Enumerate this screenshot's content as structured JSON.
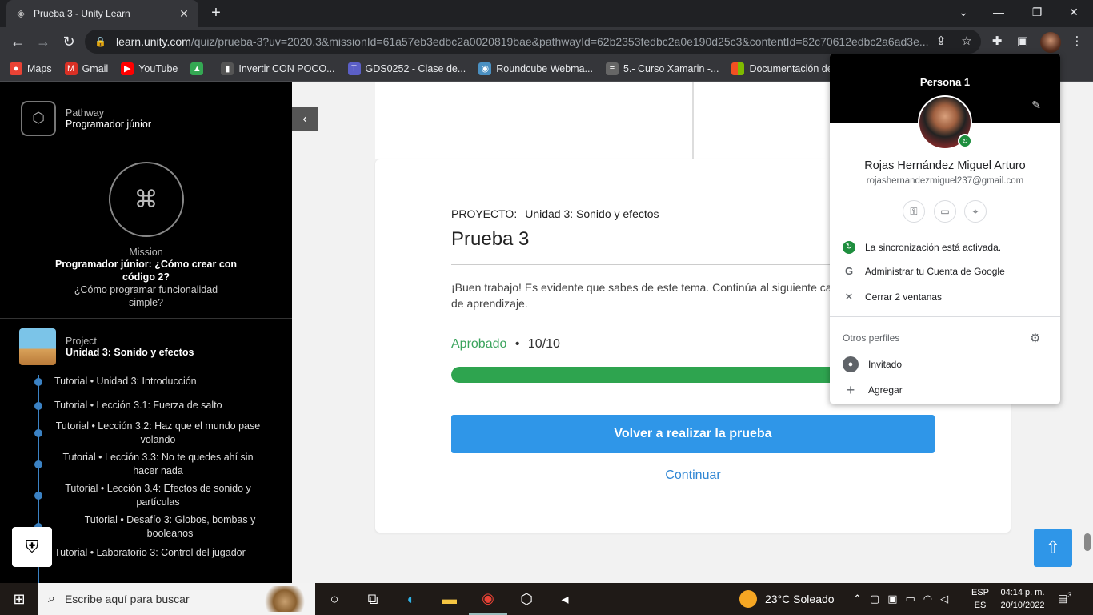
{
  "browser": {
    "tab_title": "Prueba 3 - Unity Learn",
    "url_host": "learn.unity.com",
    "url_rest": "/quiz/prueba-3?uv=2020.3&missionId=61a57eb3edbc2a0020819bae&pathwayId=62b2353fedbc2a0e190d25c3&contentId=62c70612edbc2a6ad3e...",
    "bookmarks": [
      {
        "label": "Maps",
        "icon": "maps-icon",
        "color": "#ea4335"
      },
      {
        "label": "Gmail",
        "icon": "gmail-icon",
        "color": "#d93025"
      },
      {
        "label": "YouTube",
        "icon": "youtube-icon",
        "color": "#ff0000"
      },
      {
        "label": "",
        "icon": "drive-icon",
        "color": "#34a853"
      },
      {
        "label": "Invertir CON POCO...",
        "icon": "person-icon",
        "color": "#555555"
      },
      {
        "label": "GDS0252 - Clase de...",
        "icon": "teams-icon",
        "color": "#5b5fc7"
      },
      {
        "label": "Roundcube Webma...",
        "icon": "roundcube-icon",
        "color": "#4a90c2"
      },
      {
        "label": "5.- Curso Xamarin -...",
        "icon": "doc-icon",
        "color": "#666666"
      },
      {
        "label": "Documentación de...",
        "icon": "microsoft-icon",
        "color": "#f25022"
      }
    ]
  },
  "sidebar": {
    "pathway_label": "Pathway",
    "pathway_title": "Programador júnior",
    "mission_label": "Mission",
    "mission_title": "Programador júnior: ¿Cómo crear con código 2?",
    "mission_subtitle": "¿Cómo programar funcionalidad simple?",
    "project_label": "Project",
    "project_title": "Unidad 3: Sonido y efectos",
    "tutorials": [
      {
        "line1": "Tutorial • Unidad 3: Introducción",
        "line2": ""
      },
      {
        "line1": "Tutorial • Lección 3.1: Fuerza de salto",
        "line2": ""
      },
      {
        "line1": "Tutorial • Lección 3.2: Haz que el mundo pase",
        "line2": "volando"
      },
      {
        "line1": "Tutorial • Lección 3.3: No te quedes ahí sin",
        "line2": "hacer nada"
      },
      {
        "line1": "Tutorial • Lección 3.4: Efectos de sonido y",
        "line2": "partículas"
      },
      {
        "line1": "Tutorial • Desafío 3: Globos, bombas y",
        "line2": "booleanos"
      },
      {
        "line1": "Tutorial • Laboratorio 3: Control del jugador",
        "line2": ""
      }
    ]
  },
  "quiz": {
    "project_label": "PROYECTO:",
    "project_name": "Unidad 3: Sonido y efectos",
    "title": "Prueba 3",
    "message": "¡Buen trabajo! Es evidente que sabes de este tema. Continúa al siguiente camino de aprendizaje.",
    "status": "Aprobado",
    "score": "10/10",
    "progress": 1.0,
    "retry_label": "Volver a realizar la prueba",
    "continue_label": "Continuar"
  },
  "profile": {
    "header": "Persona 1",
    "name": "Rojas Hernández Miguel Arturo",
    "email": "rojashernandezmiguel237@gmail.com",
    "sync_text": "La sincronización está activada.",
    "manage_text": "Administrar tu Cuenta de Google",
    "close_text": "Cerrar 2 ventanas",
    "other_profiles": "Otros perfiles",
    "guest": "Invitado",
    "add": "Agregar"
  },
  "taskbar": {
    "search_placeholder": "Escribe aquí para buscar",
    "weather": "23°C  Soleado",
    "lang_top": "ESP",
    "lang_bottom": "ES",
    "time": "04:14 p. m.",
    "date": "20/10/2022",
    "notifications": "3"
  }
}
